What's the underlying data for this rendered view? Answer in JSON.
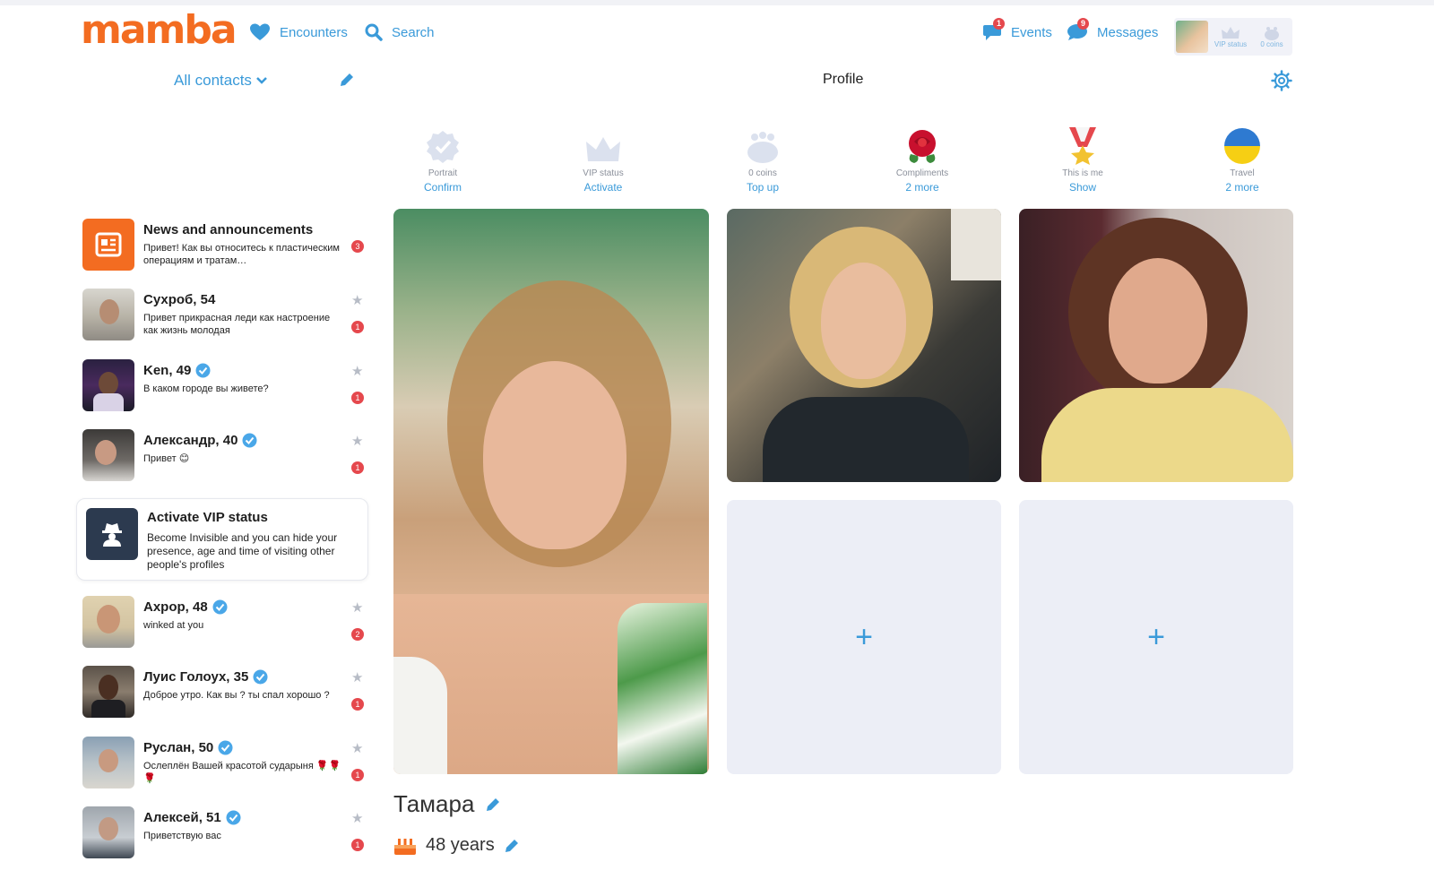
{
  "app": {
    "logo": "mamba"
  },
  "nav": {
    "encounters": "Encounters",
    "search": "Search",
    "events": "Events",
    "events_badge": "1",
    "messages": "Messages",
    "messages_badge": "9"
  },
  "user_box": {
    "vip_label": "VIP status",
    "coins_label": "0 coins"
  },
  "contacts": {
    "header": "All contacts",
    "items": [
      {
        "name": "News and announcements",
        "message": "Привет! Как вы относитесь к пластическим операциям и тратам…",
        "count": "3",
        "verified": false
      },
      {
        "name": "Сухроб, 54",
        "message": "Привет прикрасная леди как настроение как жизнь молодая",
        "count": "1",
        "verified": false
      },
      {
        "name": "Ken, 49",
        "message": "В каком городе вы живете?",
        "count": "1",
        "verified": true
      },
      {
        "name": "Александр, 40",
        "message": "Привет 😊",
        "count": "1",
        "verified": true
      },
      {
        "name": "Ахрор, 48",
        "message": "winked at you",
        "count": "2",
        "verified": true
      },
      {
        "name": "Луис Голоух, 35",
        "message": "Доброе утро. Как вы ? ты спал хорошо ?",
        "count": "1",
        "verified": true
      },
      {
        "name": "Руслан, 50",
        "message": "Ослеплён Вашей красотой сударыня 🌹🌹🌹",
        "count": "1",
        "verified": true
      },
      {
        "name": "Алексей, 51",
        "message": "Приветствую вас",
        "count": "1",
        "verified": true
      }
    ]
  },
  "vip_promo": {
    "title": "Activate VIP status",
    "description": "Become Invisible and you can hide your presence, age and time of visiting other people's profiles"
  },
  "profile": {
    "title": "Profile",
    "name": "Тамара",
    "age": "48 years",
    "stats": [
      {
        "label": "Portrait",
        "action": "Confirm",
        "icon": "badge-check-icon"
      },
      {
        "label": "VIP status",
        "action": "Activate",
        "icon": "crown-icon"
      },
      {
        "label": "0 coins",
        "action": "Top up",
        "icon": "coin-bag-icon"
      },
      {
        "label": "Compliments",
        "action": "2 more",
        "icon": "rose-icon"
      },
      {
        "label": "This is me",
        "action": "Show",
        "icon": "medal-icon"
      },
      {
        "label": "Travel",
        "action": "2 more",
        "icon": "ukraine-flag-icon"
      }
    ],
    "add_photo": "+"
  },
  "colors": {
    "accent": "#3a9ad9",
    "brand": "#f36c21",
    "badge": "#e5484d",
    "slot_bg": "#eceef6"
  }
}
